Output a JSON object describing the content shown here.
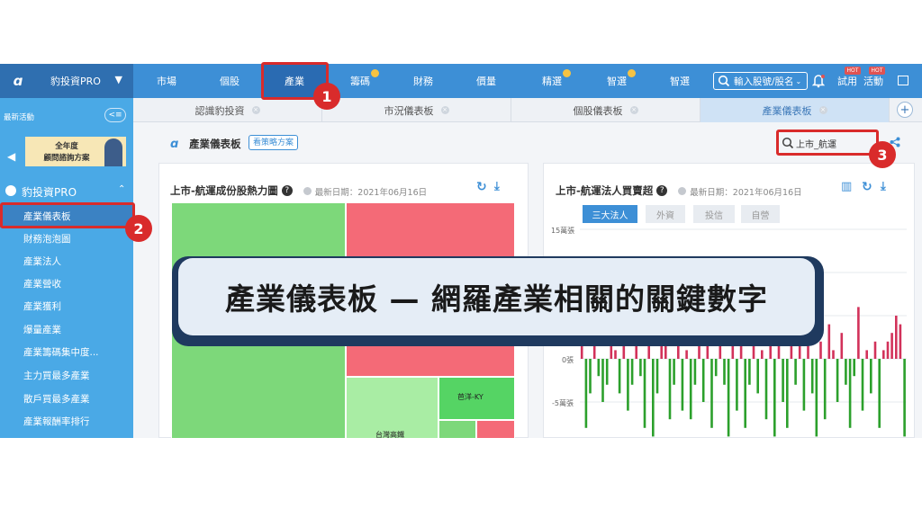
{
  "topnav": {
    "brand": "豹投資PRO",
    "items": [
      "市場",
      "個股",
      "產業",
      "籌碼",
      "財務",
      "價量",
      "精選",
      "智選",
      "智選"
    ],
    "search_placeholder": "輸入股號/股名",
    "trial": "試用",
    "activity": "活動",
    "hot": "HOT"
  },
  "tabs": [
    "認識豹投資",
    "市況儀表板",
    "個股儀表板",
    "產業儀表板"
  ],
  "sidebar": {
    "latest": "最新活動",
    "promo_line1": "全年度",
    "promo_line2": "顧問諮詢方案",
    "section": "豹投資PRO",
    "items": [
      "產業儀表板",
      "財務泡泡圖",
      "產業法人",
      "產業營收",
      "產業獲利",
      "爆量產業",
      "產業籌碼集中度...",
      "主力買最多產業",
      "散戶買最多產業",
      "產業報酬率排行"
    ]
  },
  "main": {
    "title": "產業儀表板",
    "strategy_button": "看策略方案",
    "search_value": "上市_航運",
    "left_card": {
      "title": "上市-航運成份股熱力圖",
      "date": "最新日期：2021年06月16日",
      "tiles": [
        "芭洋-KY",
        "台灣高鐵"
      ]
    },
    "right_card": {
      "title": "上市-航運法人買賣超",
      "date": "最新日期：2021年06月16日",
      "filters": [
        "三大法人",
        "外資",
        "投信",
        "自營"
      ],
      "y_ticks": [
        "15萬張",
        "0張",
        "-5萬張"
      ]
    }
  },
  "chart_data": {
    "type": "bar",
    "title": "上市-航運法人買賣超",
    "ylabel": "",
    "ylim": [
      -7,
      15
    ],
    "values": [
      6,
      -8,
      -4,
      3,
      -2,
      -5,
      -3,
      4,
      1,
      -4,
      2,
      -6,
      -3,
      5,
      -2,
      -8,
      3,
      -9,
      -4,
      2,
      5,
      -7,
      -3,
      4,
      -6,
      1,
      -7,
      -3,
      9,
      -5,
      4,
      -8,
      -2,
      6,
      -3,
      -9,
      5,
      -6,
      2,
      -8,
      -3,
      7,
      -4,
      1,
      -7,
      3,
      -9,
      4,
      -5,
      -8,
      5,
      -3,
      8,
      -6,
      3,
      -4,
      -9,
      2,
      -7,
      4,
      1,
      -5,
      3,
      -3,
      -8,
      -2,
      6,
      -6,
      1,
      -4,
      2,
      -8,
      1,
      2,
      3,
      5,
      4,
      -9
    ],
    "colors": {
      "positive": "#d2325a",
      "negative": "#2ca02c"
    }
  },
  "overlay": {
    "banner": "產業儀表板 — 網羅產業相關的關鍵數字",
    "markers": [
      "1",
      "2",
      "3"
    ],
    "colors": {
      "marker": "#d92b2b",
      "banner_border": "#1f3a5f",
      "nav": "#3d8fd6",
      "sidebar": "#4aa9e6"
    }
  }
}
